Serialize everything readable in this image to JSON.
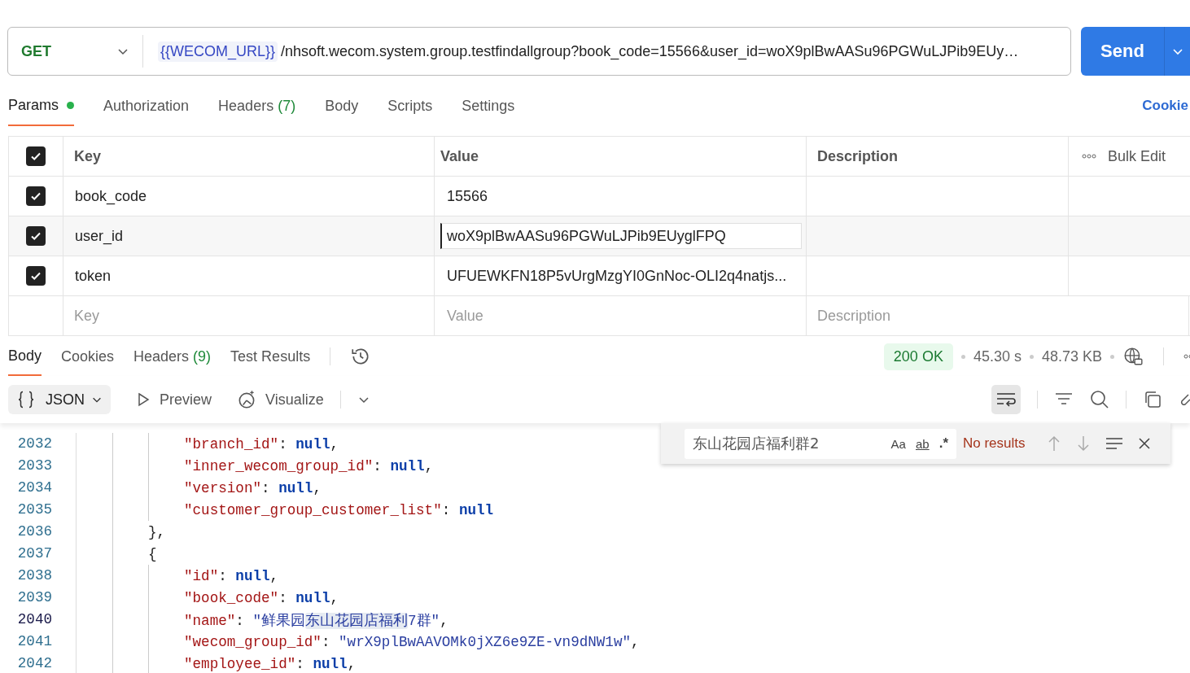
{
  "request": {
    "method": "GET",
    "url_variable": "{{WECOM_URL}}",
    "url_path": "/nhsoft.wecom.system.group.testfindallgroup?book_code=15566&user_id=woX9plBwAASu96PGWuLJPib9EUy…",
    "send": "Send"
  },
  "request_tabs": [
    {
      "label": "Params",
      "dot": true,
      "selected": true
    },
    {
      "label": "Authorization",
      "dot": false,
      "selected": false
    },
    {
      "label": "Headers",
      "count": "(7)",
      "dot": false,
      "selected": false
    },
    {
      "label": "Body",
      "dot": false,
      "selected": false
    },
    {
      "label": "Scripts",
      "dot": false,
      "selected": false
    },
    {
      "label": "Settings",
      "dot": false,
      "selected": false
    }
  ],
  "cookies_link": "Cookie",
  "params": {
    "all_checked": true,
    "columns": [
      "Key",
      "Value",
      "Description"
    ],
    "bulk_edit": "Bulk Edit",
    "rows": [
      {
        "checked": true,
        "key": "book_code",
        "value": "15566",
        "editing": false
      },
      {
        "checked": true,
        "key": "user_id",
        "value": "woX9plBwAASu96PGWuLJPib9EUyglFPQ",
        "editing": true
      },
      {
        "checked": true,
        "key": "token",
        "value": "UFUEWKFN18P5vUrgMzgYI0GnNoc-OLI2q4natjs...",
        "editing": false
      }
    ],
    "new_row": {
      "key_placeholder": "Key",
      "value_placeholder": "Value",
      "description_placeholder": "Description"
    }
  },
  "response_tabs": [
    {
      "label": "Body",
      "selected": true
    },
    {
      "label": "Cookies",
      "selected": false
    },
    {
      "label": "Headers",
      "count": "(9)",
      "selected": false
    },
    {
      "label": "Test Results",
      "selected": false
    }
  ],
  "status": {
    "code": "200 OK",
    "time": "45.30 s",
    "size": "48.73 KB"
  },
  "format": "JSON",
  "preview": "Preview",
  "visualize": "Visualize",
  "wrap_on": true,
  "search": {
    "value": "东山花园店福利群2",
    "options": [
      "Aa",
      "ab",
      ".*"
    ],
    "result": "No results"
  },
  "code": [
    {
      "children": [
        {
          "children": [
            {
              "children": [
                {
                  "number": "2032",
                  "current": false,
                  "parts": [
                    {
                      "kind": "key",
                      "text": "\"branch_id\""
                    },
                    {
                      "kind": "punct",
                      "text": ": "
                    },
                    {
                      "kind": "null",
                      "text": "null"
                    },
                    {
                      "kind": "punct",
                      "text": ","
                    }
                  ]
                },
                {
                  "number": "2033",
                  "current": false,
                  "parts": [
                    {
                      "kind": "key",
                      "text": "\"inner_wecom_group_id\""
                    },
                    {
                      "kind": "punct",
                      "text": ": "
                    },
                    {
                      "kind": "null",
                      "text": "null"
                    },
                    {
                      "kind": "punct",
                      "text": ","
                    }
                  ]
                },
                {
                  "number": "2034",
                  "current": false,
                  "parts": [
                    {
                      "kind": "key",
                      "text": "\"version\""
                    },
                    {
                      "kind": "punct",
                      "text": ": "
                    },
                    {
                      "kind": "null",
                      "text": "null"
                    },
                    {
                      "kind": "punct",
                      "text": ","
                    }
                  ]
                },
                {
                  "number": "2035",
                  "current": false,
                  "parts": [
                    {
                      "kind": "key",
                      "text": "\"customer_group_customer_list\""
                    },
                    {
                      "kind": "punct",
                      "text": ": "
                    },
                    {
                      "kind": "null",
                      "text": "null"
                    }
                  ]
                }
              ]
            },
            {
              "number": "2036",
              "current": false,
              "parts": [
                {
                  "kind": "punct",
                  "text": "},"
                }
              ]
            },
            {
              "number": "2037",
              "current": false,
              "parts": [
                {
                  "kind": "punct",
                  "text": "{"
                }
              ]
            },
            {
              "children": [
                {
                  "number": "2038",
                  "current": false,
                  "parts": [
                    {
                      "kind": "key",
                      "text": "\"id\""
                    },
                    {
                      "kind": "punct",
                      "text": ": "
                    },
                    {
                      "kind": "null",
                      "text": "null"
                    },
                    {
                      "kind": "punct",
                      "text": ","
                    }
                  ]
                },
                {
                  "number": "2039",
                  "current": false,
                  "parts": [
                    {
                      "kind": "key",
                      "text": "\"book_code\""
                    },
                    {
                      "kind": "punct",
                      "text": ": "
                    },
                    {
                      "kind": "null",
                      "text": "null"
                    },
                    {
                      "kind": "punct",
                      "text": ","
                    }
                  ]
                },
                {
                  "number": "2040",
                  "current": true,
                  "parts": [
                    {
                      "kind": "key",
                      "text": "\"name\""
                    },
                    {
                      "kind": "punct",
                      "text": ": "
                    },
                    {
                      "kind": "string",
                      "text": "\"鲜果园"
                    },
                    {
                      "kind": "match",
                      "text": "东山花园店福利"
                    },
                    {
                      "kind": "string",
                      "text": "7群\""
                    },
                    {
                      "kind": "punct",
                      "text": ","
                    }
                  ]
                },
                {
                  "number": "2041",
                  "current": false,
                  "parts": [
                    {
                      "kind": "key",
                      "text": "\"wecom_group_id\""
                    },
                    {
                      "kind": "punct",
                      "text": ": "
                    },
                    {
                      "kind": "string",
                      "text": "\"wrX9plBwAAVOMk0jXZ6e9ZE-vn9dNW1w\""
                    },
                    {
                      "kind": "punct",
                      "text": ","
                    }
                  ]
                },
                {
                  "number": "2042",
                  "current": false,
                  "parts": [
                    {
                      "kind": "key",
                      "text": "\"employee_id\""
                    },
                    {
                      "kind": "punct",
                      "text": ": "
                    },
                    {
                      "kind": "null",
                      "text": "null"
                    },
                    {
                      "kind": "punct",
                      "text": ","
                    }
                  ]
                }
              ]
            }
          ]
        }
      ]
    }
  ]
}
